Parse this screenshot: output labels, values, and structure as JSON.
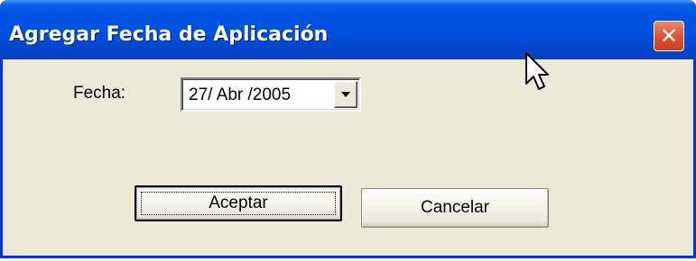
{
  "window": {
    "title": "Agregar Fecha de Aplicación",
    "close_label": "✕"
  },
  "form": {
    "date_label": "Fecha:",
    "date_value": "27/ Abr /2005"
  },
  "buttons": {
    "accept_label": "Aceptar",
    "cancel_label": "Cancelar"
  },
  "icons": {
    "close": "close-icon",
    "dropdown": "chevron-down-icon",
    "cursor": "mouse-pointer-icon"
  },
  "colors": {
    "titlebar": "#0055e5",
    "close_button": "#e0593a",
    "window_face": "#ece9d8"
  }
}
